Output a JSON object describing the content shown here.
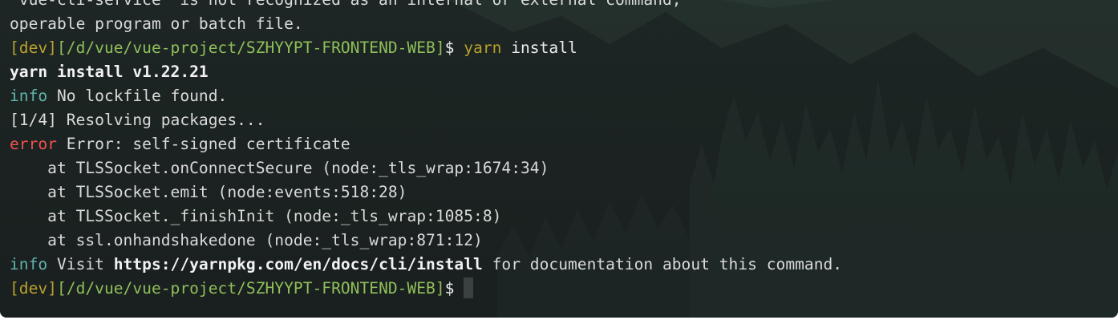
{
  "colors": {
    "prompt": "#b9a12c",
    "path": "#8fbf5a",
    "info": "#5fb4ab",
    "error": "#f0524f",
    "text": "#dadada",
    "background": "#1b2322"
  },
  "terminal": {
    "lines": [
      {
        "segments": [
          {
            "text": "'vue-cli-service' is not recognized as an internal or external command,",
            "role": "default"
          }
        ]
      },
      {
        "segments": [
          {
            "text": "operable program or batch file.",
            "role": "default"
          }
        ]
      },
      {
        "segments": [
          {
            "text": "[dev]",
            "role": "prompt"
          },
          {
            "text": "[/d/vue/vue-project/SZHYYPT-FRONTEND-WEB]",
            "role": "path"
          },
          {
            "text": "$ ",
            "role": "bright"
          },
          {
            "text": "yarn",
            "role": "prompt"
          },
          {
            "text": " install",
            "role": "bright"
          }
        ]
      },
      {
        "segments": [
          {
            "text": "yarn install v1.22.21",
            "role": "bold"
          }
        ]
      },
      {
        "segments": [
          {
            "text": "info",
            "role": "info"
          },
          {
            "text": " No lockfile found.",
            "role": "default"
          }
        ]
      },
      {
        "segments": [
          {
            "text": "[1/4] Resolving packages...",
            "role": "default"
          }
        ]
      },
      {
        "segments": [
          {
            "text": "error",
            "role": "error"
          },
          {
            "text": " Error: self-signed certificate",
            "role": "default"
          }
        ]
      },
      {
        "segments": [
          {
            "text": "    at TLSSocket.onConnectSecure (node:_tls_wrap:1674:34)",
            "role": "default"
          }
        ]
      },
      {
        "segments": [
          {
            "text": "    at TLSSocket.emit (node:events:518:28)",
            "role": "default"
          }
        ]
      },
      {
        "segments": [
          {
            "text": "    at TLSSocket._finishInit (node:_tls_wrap:1085:8)",
            "role": "default"
          }
        ]
      },
      {
        "segments": [
          {
            "text": "    at ssl.onhandshakedone (node:_tls_wrap:871:12)",
            "role": "default"
          }
        ]
      },
      {
        "segments": [
          {
            "text": "info",
            "role": "info"
          },
          {
            "text": " Visit ",
            "role": "default"
          },
          {
            "text": "https://yarnpkg.com/en/docs/cli/install",
            "role": "bold"
          },
          {
            "text": " for documentation about this command.",
            "role": "default"
          }
        ]
      },
      {
        "segments": [
          {
            "text": "[dev]",
            "role": "prompt"
          },
          {
            "text": "[/d/vue/vue-project/SZHYYPT-FRONTEND-WEB]",
            "role": "path"
          },
          {
            "text": "$ ",
            "role": "bright"
          }
        ],
        "cursor": true
      }
    ]
  }
}
